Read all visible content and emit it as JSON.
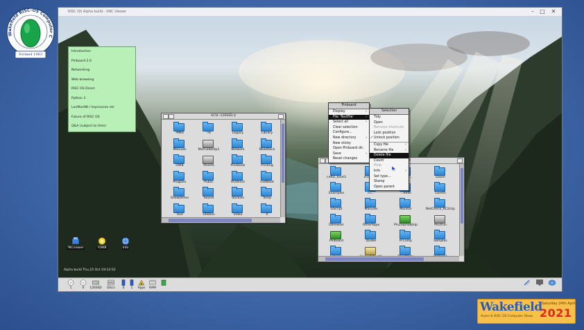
{
  "logo": {
    "ring_text": "Wakefield RISC-OS Computer Club",
    "formed": "Formed 1983"
  },
  "titlebar": {
    "text": "RISC OS Alpha build - VNC Viewer",
    "controls": [
      "–",
      "□",
      "✕"
    ]
  },
  "topics": [
    "Introduction",
    "Pinboard 2.0",
    "Networking",
    "Web browsing",
    "RISC OS Direct",
    "Python 3",
    "LanMan98 / Impression etc",
    "Future of RISC OS",
    "Q&A (subject to time)"
  ],
  "filer_left": {
    "title": "SCSI::126SSD.$",
    "items": [
      {
        "label": "!MK6",
        "type": "folder"
      },
      {
        "label": "!rk",
        "type": "folder"
      },
      {
        "label": "Legacy",
        "type": "folder"
      },
      {
        "label": "Library",
        "type": "folder"
      },
      {
        "label": "Manuals",
        "type": "folder"
      },
      {
        "label": "MerCode/dp1",
        "type": "app"
      },
      {
        "label": "Network",
        "type": "folder"
      },
      {
        "label": "NewStack",
        "type": "folder"
      },
      {
        "label": "OWB",
        "type": "folder"
      },
      {
        "label": "PinInfo",
        "type": "app"
      },
      {
        "label": "Pinebook",
        "type": "folder"
      },
      {
        "label": "Printing",
        "type": "folder"
      },
      {
        "label": "ProgDev",
        "type": "folder"
      },
      {
        "label": "Public",
        "type": "folder"
      },
      {
        "label": "ROdirect",
        "type": "folder"
      },
      {
        "label": "rootBoot",
        "type": "folder"
      },
      {
        "label": "ShowDemo",
        "type": "folder"
      },
      {
        "label": "Sound",
        "type": "folder"
      },
      {
        "label": "Stickies",
        "type": "folder"
      },
      {
        "label": "Temp",
        "type": "folder"
      },
      {
        "label": "Text",
        "type": "folder"
      },
      {
        "label": "Utilities",
        "type": "folder"
      },
      {
        "label": "Video",
        "type": "folder"
      },
      {
        "label": "X",
        "type": "folder"
      }
    ]
  },
  "filer_right": {
    "title": "...ms",
    "items": [
      {
        "label": "celtic_knot3",
        "type": "folder"
      },
      {
        "label": "chalcube",
        "type": "folder"
      },
      {
        "label": "...elegr...",
        "type": "folder"
      },
      {
        "label": "Doom",
        "type": "folder"
      },
      {
        "label": "Examples",
        "type": "folder"
      },
      {
        "label": "FL...",
        "type": "folder"
      },
      {
        "label": "...ends",
        "type": "folder"
      },
      {
        "label": "Gareth",
        "type": "folder"
      },
      {
        "label": "GScript",
        "type": "folder"
      },
      {
        "label": "Manuals",
        "type": "folder"
      },
      {
        "label": "Monitor",
        "type": "folder"
      },
      {
        "label": "NetCheck_RC2/zip",
        "type": "folder"
      },
      {
        "label": "OBrowser",
        "type": "folder"
      },
      {
        "label": "OtherApps",
        "type": "folder"
      },
      {
        "label": "Pin2alphaB/zip",
        "type": "app2"
      },
      {
        "label": "Pin2run",
        "type": "app"
      },
      {
        "label": "Pinboard",
        "type": "app2"
      },
      {
        "label": "Quake",
        "type": "folder"
      },
      {
        "label": "R-Comp",
        "type": "folder"
      },
      {
        "label": "Samples",
        "type": "folder"
      },
      {
        "label": "Schema",
        "type": "folder"
      },
      {
        "label": "Spreadsheet1",
        "type": "tool"
      },
      {
        "label": "ThirdParty",
        "type": "folder"
      },
      {
        "label": "UnBack1",
        "type": "folder"
      }
    ]
  },
  "pinboard_menu": {
    "title": "Pinboard",
    "items": [
      {
        "label": "Display",
        "arrow": true,
        "separator_after": false,
        "highlight": false
      },
      {
        "label": "File 'TextFile'",
        "arrow": true,
        "separator_after": false,
        "highlight": true
      },
      {
        "label": "Select all",
        "arrow": true,
        "separator_after": false,
        "highlight": false
      },
      {
        "label": "Clear selection",
        "arrow": false,
        "separator_after": false,
        "highlight": false
      },
      {
        "label": "Configure...",
        "arrow": false,
        "separator_after": false,
        "highlight": false
      },
      {
        "label": "New directory",
        "arrow": true,
        "separator_after": false,
        "highlight": false
      },
      {
        "label": "New sticky",
        "arrow": false,
        "separator_after": false,
        "highlight": false
      },
      {
        "label": "Open Pinboard dir.",
        "arrow": false,
        "separator_after": false,
        "highlight": false
      },
      {
        "label": "Save",
        "arrow": true,
        "separator_after": false,
        "highlight": false
      },
      {
        "label": "Reset changes",
        "arrow": false,
        "separator_after": false,
        "highlight": false
      }
    ]
  },
  "selection_menu": {
    "title": "Selection",
    "items": [
      {
        "label": "Tidy",
        "dim": false,
        "arrow": false,
        "tick": false,
        "highlight": false,
        "sep": false
      },
      {
        "label": "Open",
        "dim": false,
        "arrow": false,
        "tick": false,
        "highlight": false,
        "sep": false
      },
      {
        "label": "Remove shortcuts",
        "dim": true,
        "arrow": false,
        "tick": false,
        "highlight": false,
        "sep": false
      },
      {
        "label": "Lock position",
        "dim": false,
        "arrow": false,
        "tick": false,
        "highlight": false,
        "sep": false
      },
      {
        "label": "Unlock position",
        "dim": false,
        "arrow": false,
        "tick": true,
        "highlight": false,
        "sep": true
      },
      {
        "label": "Copy file",
        "dim": false,
        "arrow": true,
        "tick": false,
        "highlight": false,
        "sep": false
      },
      {
        "label": "Rename file",
        "dim": false,
        "arrow": true,
        "tick": false,
        "highlight": false,
        "sep": false
      },
      {
        "label": "Delete file",
        "dim": false,
        "arrow": false,
        "tick": false,
        "highlight": true,
        "sep": false
      },
      {
        "label": "Count",
        "dim": false,
        "arrow": false,
        "tick": false,
        "highlight": false,
        "sep": false
      },
      {
        "label": "Help",
        "dim": true,
        "arrow": false,
        "tick": false,
        "highlight": false,
        "sep": false
      },
      {
        "label": "Info",
        "dim": false,
        "arrow": true,
        "tick": false,
        "highlight": false,
        "sep": false
      },
      {
        "label": "Set type...",
        "dim": false,
        "arrow": false,
        "tick": false,
        "highlight": false,
        "sep": false
      },
      {
        "label": "Stamp",
        "dim": false,
        "arrow": false,
        "tick": false,
        "highlight": false,
        "sep": false
      },
      {
        "label": "Open parent",
        "dim": false,
        "arrow": false,
        "tick": false,
        "highlight": false,
        "sep": false
      }
    ]
  },
  "desktop_icons": [
    {
      "label": "!NCviewer",
      "icon": "network-viewer-icon"
    },
    {
      "label": "!OWB",
      "icon": "owb-browser-icon"
    },
    {
      "label": "Info",
      "icon": "globe-icon"
    }
  ],
  "status_text": "Alpha build Thu,15 Oct 19:13:52",
  "iconbar": [
    {
      "label": "1",
      "icon": "floppy-drive-icon"
    },
    {
      "label": "0",
      "icon": "floppy-drive-icon"
    },
    {
      "label": "126SSD",
      "icon": "hard-disc-icon"
    },
    {
      "label": "Discs",
      "icon": "discs-icon"
    },
    {
      "label": "0",
      "icon": "memory-stick-icon"
    },
    {
      "label": "1",
      "icon": "memory-stick-icon"
    },
    {
      "label": "Apps",
      "icon": "apps-icon"
    },
    {
      "label": "RAM",
      "icon": "ram-disc-icon"
    },
    {
      "label": "",
      "icon": "recycle-bin-icon"
    }
  ],
  "iconbar_right": [
    {
      "icon": "network-tools-icon"
    },
    {
      "icon": "display-icon"
    },
    {
      "icon": "risc-os-cube-icon"
    }
  ],
  "wakefield": {
    "main": "Wakefield",
    "sub": "Acorn & RISC OS Computer Show",
    "date": "Saturday 24th April",
    "year": "2021"
  }
}
